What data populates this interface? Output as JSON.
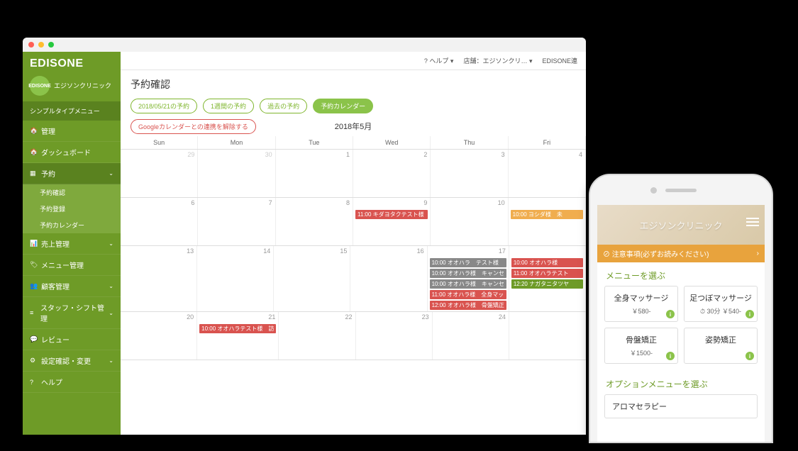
{
  "browser": {
    "logo": "EDISONE",
    "clinic_badge": "EDISONE",
    "clinic_name": "エジソンクリニック",
    "simple_menu": "シンプルタイプメニュー",
    "topbar": {
      "help": "? ヘルプ ▾",
      "store": "店舗：エジソンクリ… ▾",
      "link": "EDISONE連"
    },
    "nav": [
      {
        "icon": "🏠",
        "label": "管理"
      },
      {
        "icon": "🏠",
        "label": "ダッシュボード"
      },
      {
        "icon": "▦",
        "label": "予約",
        "open": true,
        "sub": [
          "予約確認",
          "予約登録",
          "予約カレンダー"
        ]
      },
      {
        "icon": "📊",
        "label": "売上管理",
        "chev": true
      },
      {
        "icon": "🏷",
        "label": "メニュー管理"
      },
      {
        "icon": "👥",
        "label": "顧客管理",
        "chev": true
      },
      {
        "icon": "≡",
        "label": "スタッフ・シフト管理",
        "chev": true
      },
      {
        "icon": "💬",
        "label": "レビュー"
      },
      {
        "icon": "⚙",
        "label": "設定確認・変更",
        "chev": true
      },
      {
        "icon": "?",
        "label": "ヘルプ"
      }
    ],
    "page_title": "予約確認",
    "pills": [
      {
        "label": "2018/05/21の予約"
      },
      {
        "label": "1週間の予約"
      },
      {
        "label": "過去の予約"
      },
      {
        "label": "予約カレンダー",
        "active": true
      }
    ],
    "unlink_pill": "Googleカレンダーとの連携を解除する",
    "month": "2018年5月",
    "dow": [
      "Sun",
      "Mon",
      "Tue",
      "Wed",
      "Thu",
      "Fri"
    ],
    "weeks": [
      {
        "dates": [
          "29",
          "30",
          "1",
          "2",
          "3",
          "4"
        ],
        "prev": [
          0,
          1
        ],
        "events": {}
      },
      {
        "dates": [
          "6",
          "7",
          "8",
          "9",
          "10",
          ""
        ],
        "events": {
          "3": [
            {
              "t": "11:00 キダヨタクテスト様",
              "c": "red"
            }
          ],
          "5": [
            {
              "t": "10:00 ヨシダ様　未",
              "c": "orange"
            }
          ]
        }
      },
      {
        "dates": [
          "13",
          "14",
          "15",
          "16",
          "17",
          ""
        ],
        "events": {
          "4": [
            {
              "t": "10:00 オオハラ　テスト様",
              "c": "gray"
            },
            {
              "t": "10:00 オオハラ様　キャンセ",
              "c": "gray"
            },
            {
              "t": "10:00 オオハラ様　キャンセ",
              "c": "gray"
            },
            {
              "t": "11:00 オオハラ様　全身マッ",
              "c": "red"
            },
            {
              "t": "12:00 オオハラ様　骨盤矯正",
              "c": "red"
            }
          ],
          "5": [
            {
              "t": "10:00 オオハラ様",
              "c": "red"
            },
            {
              "t": "11:00 オオハラテスト",
              "c": "red"
            },
            {
              "t": "12:20 ナガタニタツヤ",
              "c": "green"
            }
          ]
        }
      },
      {
        "dates": [
          "20",
          "21",
          "22",
          "23",
          "24",
          ""
        ],
        "events": {
          "1": [
            {
              "t": "10:00 オオハラテスト様　訪",
              "c": "red"
            }
          ]
        }
      }
    ]
  },
  "phone": {
    "hero_title": "エジソンクリニック",
    "notice": "⊘ 注意事項(必ずお読みください)",
    "section_menu": "メニューを選ぶ",
    "menus": [
      {
        "name": "全身マッサージ",
        "price": "￥580-"
      },
      {
        "name": "足つぼマッサージ",
        "price": "⏱ 30分 ￥540-"
      },
      {
        "name": "骨盤矯正",
        "price": "￥1500-"
      },
      {
        "name": "姿勢矯正",
        "price": ""
      }
    ],
    "section_option": "オプションメニューを選ぶ",
    "options": [
      "アロマセラピー"
    ]
  }
}
